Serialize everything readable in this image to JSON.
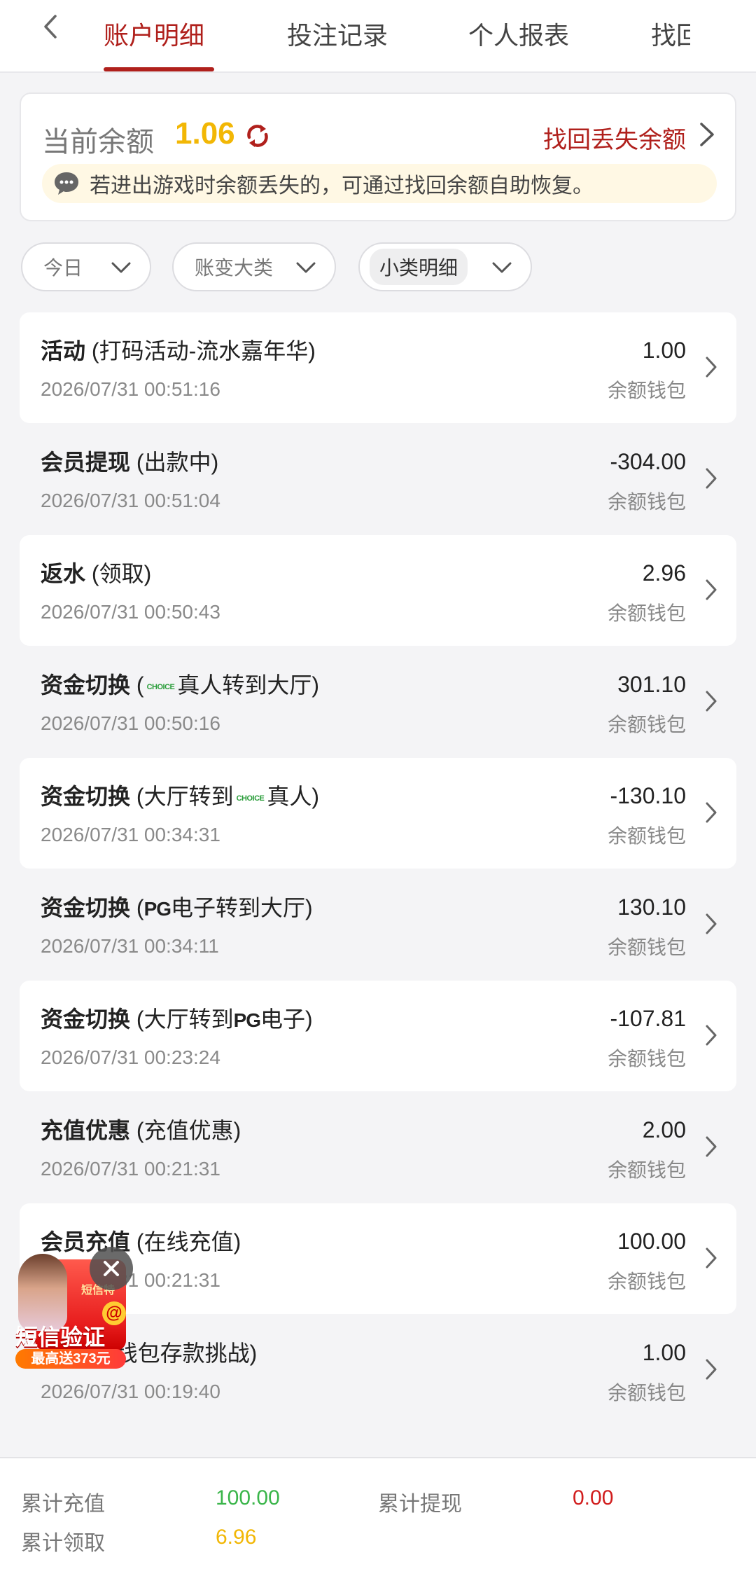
{
  "header": {
    "tabs": [
      {
        "label": "账户明细",
        "active": true
      },
      {
        "label": "投注记录",
        "active": false
      },
      {
        "label": "个人报表",
        "active": false
      },
      {
        "label": "找回",
        "active": false
      }
    ]
  },
  "balance": {
    "label": "当前余额",
    "value": "1.06",
    "recover_link": "找回丢失余额",
    "notice": "若进出游戏时余额丢失的，可通过找回余额自助恢复。"
  },
  "filters": [
    {
      "label": "今日"
    },
    {
      "label": "账变大类"
    },
    {
      "label": "小类明细"
    }
  ],
  "transactions": [
    {
      "category": "活动",
      "detail_prefix": " (打码活动-流水嘉年华)",
      "detail_logo": "",
      "detail_suffix": "",
      "datetime": "2026/07/31 00:51:16",
      "amount": "1.00",
      "wallet": "余额钱包"
    },
    {
      "category": "会员提现",
      "detail_prefix": " (出款中)",
      "detail_logo": "",
      "detail_suffix": "",
      "datetime": "2026/07/31 00:51:04",
      "amount": "-304.00",
      "wallet": "余额钱包"
    },
    {
      "category": "返水",
      "detail_prefix": " (领取)",
      "detail_logo": "",
      "detail_suffix": "",
      "datetime": "2026/07/31 00:50:43",
      "amount": "2.96",
      "wallet": "余额钱包"
    },
    {
      "category": "资金切换",
      "detail_prefix": " (",
      "detail_logo": "CHOICE",
      "detail_suffix": "真人转到大厅)",
      "datetime": "2026/07/31 00:50:16",
      "amount": "301.10",
      "wallet": "余额钱包"
    },
    {
      "category": "资金切换",
      "detail_prefix": " (大厅转到",
      "detail_logo": "CHOICE",
      "detail_suffix": "真人)",
      "datetime": "2026/07/31 00:34:31",
      "amount": "-130.10",
      "wallet": "余额钱包"
    },
    {
      "category": "资金切换",
      "detail_prefix": " (",
      "detail_logo": "PG",
      "detail_suffix": "电子转到大厅)",
      "datetime": "2026/07/31 00:34:11",
      "amount": "130.10",
      "wallet": "余额钱包"
    },
    {
      "category": "资金切换",
      "detail_prefix": " (大厅转到",
      "detail_logo": "PG",
      "detail_suffix": "电子)",
      "datetime": "2026/07/31 00:23:24",
      "amount": "-107.81",
      "wallet": "余额钱包"
    },
    {
      "category": "充值优惠",
      "detail_prefix": " (充值优惠)",
      "detail_logo": "",
      "detail_suffix": "",
      "datetime": "2026/07/31 00:21:31",
      "amount": "2.00",
      "wallet": "余额钱包"
    },
    {
      "category": "会员充值",
      "detail_prefix": " (在线充值)",
      "detail_logo": "",
      "detail_suffix": "",
      "datetime": "2026/07/31 00:21:31",
      "amount": "100.00",
      "wallet": "余额钱包"
    },
    {
      "category": "",
      "detail_prefix": "值活动-钱包存款挑战)",
      "detail_logo": "",
      "detail_suffix": "",
      "datetime": "2026/07/31 00:19:40",
      "amount": "1.00",
      "wallet": "余额钱包"
    }
  ],
  "summary": {
    "total_deposit_label": "累计充值",
    "total_deposit_value": "100.00",
    "total_withdraw_label": "累计提现",
    "total_withdraw_value": "0.00",
    "total_claim_label": "累计领取",
    "total_claim_value": "6.96"
  },
  "float_ad": {
    "small_text": "短信特",
    "main_text": "短信验证",
    "sub_text": "最高送373元"
  },
  "colors": {
    "accent": "#b0201c",
    "balance": "#f2b705",
    "deposit": "#3ab54a",
    "withdraw": "#d11d1d",
    "claim": "#f2b705"
  }
}
